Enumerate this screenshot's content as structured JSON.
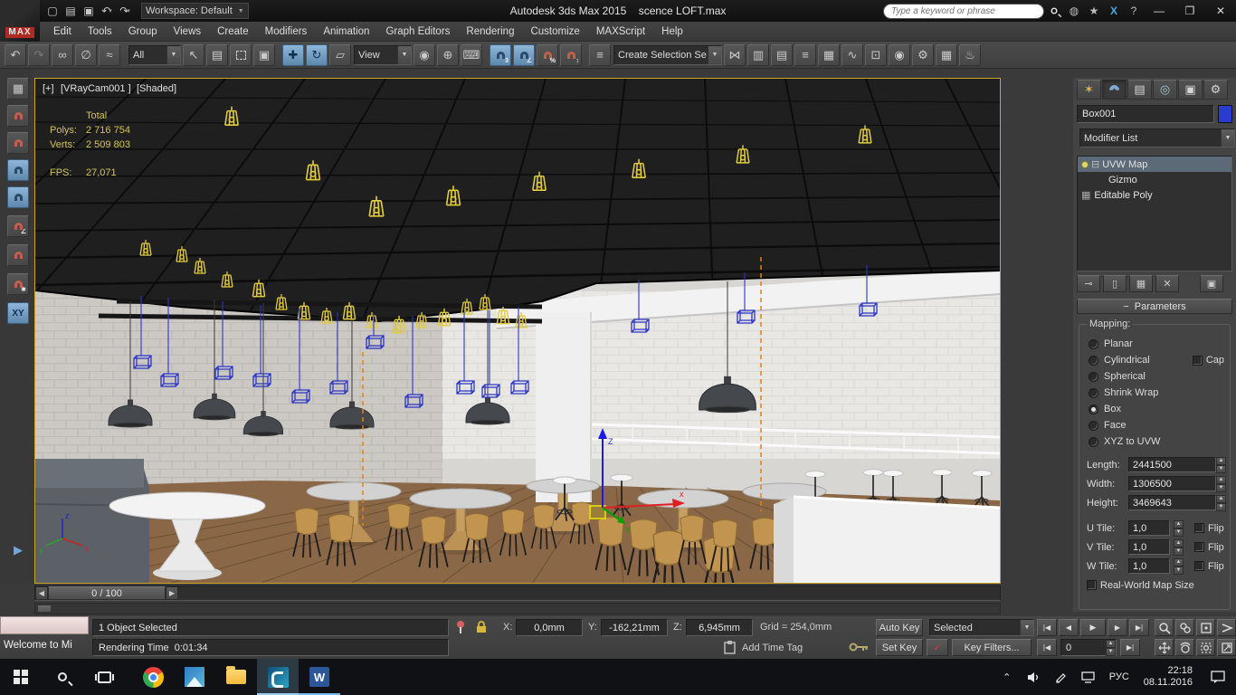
{
  "window": {
    "title": "Autodesk 3ds Max 2015    scence LOFT.max",
    "workspace": "Workspace: Default",
    "search_placeholder": "Type a keyword or phrase"
  },
  "menus": [
    "Edit",
    "Tools",
    "Group",
    "Views",
    "Create",
    "Modifiers",
    "Animation",
    "Graph Editors",
    "Rendering",
    "Customize",
    "MAXScript",
    "Help"
  ],
  "toolbar": {
    "selection_filter": "All",
    "ref_coord": "View",
    "named_selection": "Create Selection Se",
    "snap_mode": "3"
  },
  "viewport": {
    "label_plus": "[+]",
    "label_camera": "[VRayCam001 ]",
    "label_shading": "[Shaded]",
    "stats": {
      "total_label": "Total",
      "polys_label": "Polys:",
      "polys_value": "2 716 754",
      "verts_label": "Verts:",
      "verts_value": "2 509 803",
      "fps_label": "FPS:",
      "fps_value": "27,071"
    },
    "gizmo": {
      "x": "x",
      "y": "Y",
      "z": "Z"
    },
    "axis_tripod": {
      "x": "x",
      "y": "y",
      "z": "z"
    }
  },
  "time_slider": {
    "handle": "0 / 100"
  },
  "status_bar": {
    "welcome_title": "Welcome to Mi",
    "selection_status": "1 Object Selected",
    "prompt": "Rendering Time  0:01:34",
    "coord_x_label": "X:",
    "coord_x": "0,0mm",
    "coord_y_label": "Y:",
    "coord_y": "-162,21mm",
    "coord_z_label": "Z:",
    "coord_z": "6,945mm",
    "grid_readout": "Grid = 254,0mm",
    "add_time_tag": "Add Time Tag"
  },
  "animation_controls": {
    "auto_key": "Auto Key",
    "set_key": "Set Key",
    "key_mode": "Selected",
    "key_filters": "Key Filters...",
    "frame": "0"
  },
  "command_panel": {
    "object_name": "Box001",
    "modifier_list": "Modifier List",
    "stack": {
      "uvw_map": "UVW Map",
      "gizmo": "Gizmo",
      "editable_poly": "Editable Poly"
    },
    "rollout": "Parameters",
    "mapping": {
      "group_label": "Mapping:",
      "options": [
        "Planar",
        "Cylindrical",
        "Spherical",
        "Shrink Wrap",
        "Box",
        "Face",
        "XYZ to UVW"
      ],
      "cap": "Cap",
      "length_label": "Length:",
      "length": "2441500",
      "width_label": "Width:",
      "width": "1306500",
      "height_label": "Height:",
      "height": "3469643",
      "u_tile_label": "U Tile:",
      "u_tile": "1,0",
      "v_tile_label": "V Tile:",
      "v_tile": "1,0",
      "w_tile_label": "W Tile:",
      "w_tile": "1,0",
      "flip": "Flip",
      "real_world": "Real-World Map Size"
    }
  },
  "taskbar": {
    "language": "РУС",
    "time": "22:18",
    "date": "08.11.2016"
  }
}
